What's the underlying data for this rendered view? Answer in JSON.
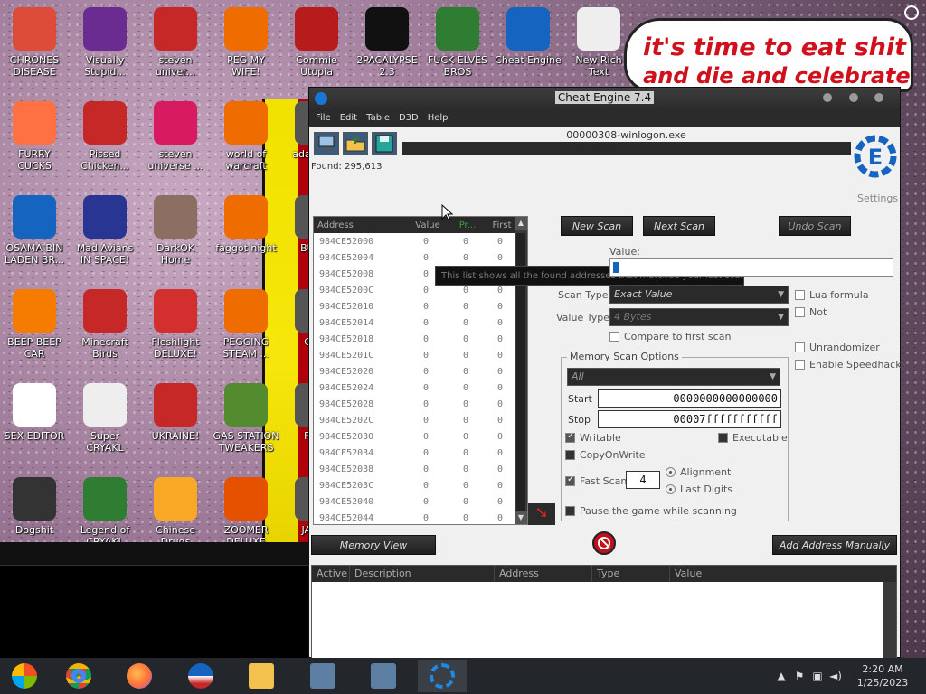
{
  "desktop": {
    "speech_line1": "it's time to eat shit",
    "speech_line2": "and die and celebrate",
    "icons": [
      {
        "label": "CHRONES DISEASE",
        "glyph": "chrome-icon",
        "color": "#dd4b39"
      },
      {
        "label": "Visually Stupid...",
        "glyph": "visual-studio-icon",
        "color": "#6a2c91"
      },
      {
        "label": "steven univer...",
        "glyph": "number-2-icon",
        "color": "#c62828"
      },
      {
        "label": "PEG MY WIFE!",
        "glyph": "p-logo-icon",
        "color": "#ef6c00"
      },
      {
        "label": "Commie Utopia",
        "glyph": "soviet-icon",
        "color": "#b71c1c"
      },
      {
        "label": "2PACALYPSE 2.3",
        "glyph": "cmd-icon",
        "color": "#111111"
      },
      {
        "label": "FUCK ELVES BROS",
        "glyph": "wizard-icon",
        "color": "#2e7d32"
      },
      {
        "label": "Cheat Engine",
        "glyph": "cheat-engine-icon",
        "color": "#1565c0"
      },
      {
        "label": "New Rich Text Document.rtf",
        "glyph": "document-icon",
        "color": "#eeeeee"
      },
      {
        "label": "FURRY CUCKS",
        "glyph": "firefox-icon",
        "color": "#ff7043"
      },
      {
        "label": "Pissed Chicken...",
        "glyph": "angry-bird-icon",
        "color": "#c62828"
      },
      {
        "label": "steven universe ...",
        "glyph": "gem-icon",
        "color": "#d81b60"
      },
      {
        "label": "world of warcraft",
        "glyph": "p-logo-icon",
        "color": "#ef6c00"
      },
      {
        "label": "adal simu",
        "glyph": "blank-icon",
        "color": "#555555"
      },
      {
        "label": "OSAMA BIN LADEN BR...",
        "glyph": "obama-logo-icon",
        "color": "#1565c0"
      },
      {
        "label": "Mad Avians IN SPACE!",
        "glyph": "angry-bird-icon",
        "color": "#283593"
      },
      {
        "label": "DarkOK Home",
        "glyph": "money-bag-icon",
        "color": "#8d6e63"
      },
      {
        "label": "faggot night",
        "glyph": "p-logo-icon",
        "color": "#ef6c00"
      },
      {
        "label": "BU OU",
        "glyph": "blank-icon",
        "color": "#555555"
      },
      {
        "label": "BEEP BEEP CAR",
        "glyph": "vlc-icon",
        "color": "#f57c00"
      },
      {
        "label": "Minecraft Birds",
        "glyph": "angry-bird-icon",
        "color": "#c62828"
      },
      {
        "label": "Fleshlight DELUXE!",
        "glyph": "red-puff-icon",
        "color": "#d32f2f"
      },
      {
        "label": "PEGGING STEAM ...",
        "glyph": "p-logo-icon",
        "color": "#ef6c00"
      },
      {
        "label": "C NU",
        "glyph": "blank-icon",
        "color": "#555555"
      },
      {
        "label": "SEX EDITOR",
        "glyph": "hxd-icon",
        "color": "#ffffff"
      },
      {
        "label": "Super CRYAKL",
        "glyph": "pixel-face-icon",
        "color": "#eeeeee"
      },
      {
        "label": "UKRAINE!",
        "glyph": "radiation-icon",
        "color": "#c62828"
      },
      {
        "label": "GAS STATION TWEAKERS",
        "glyph": "plants-icon",
        "color": "#558b2f"
      },
      {
        "label": "FREE",
        "glyph": "blank-icon",
        "color": "#555555"
      },
      {
        "label": "Dogshit",
        "glyph": "cpp-icon",
        "color": "#333333"
      },
      {
        "label": "Legend of CRYAKL",
        "glyph": "pixel-hero-icon",
        "color": "#2e7d32"
      },
      {
        "label": "Chinese Drugs",
        "glyph": "mahjong-icon",
        "color": "#f9a825"
      },
      {
        "label": "ZOOMER DELUXE",
        "glyph": "zuma-icon",
        "color": "#e65100"
      },
      {
        "label": "JA ANI",
        "glyph": "blank-icon",
        "color": "#555555"
      }
    ]
  },
  "cheat_engine": {
    "title": "Cheat Engine 7.4",
    "menu": [
      "File",
      "Edit",
      "Table",
      "D3D",
      "Help"
    ],
    "process": "00000308-winlogon.exe",
    "found": "Found: 295,613",
    "settings": "Settings",
    "results_headers": [
      "Address",
      "Value",
      "Pr...",
      "First"
    ],
    "results": [
      {
        "address": "984CE52000",
        "value": "0",
        "prev": "0",
        "first": "0"
      },
      {
        "address": "984CE52004",
        "value": "0",
        "prev": "0",
        "first": "0"
      },
      {
        "address": "984CE52008",
        "value": "0",
        "prev": "0",
        "first": "0"
      },
      {
        "address": "984CE5200C",
        "value": "0",
        "prev": "0",
        "first": "0"
      },
      {
        "address": "984CE52010",
        "value": "0",
        "prev": "0",
        "first": "0"
      },
      {
        "address": "984CE52014",
        "value": "0",
        "prev": "0",
        "first": "0"
      },
      {
        "address": "984CE52018",
        "value": "0",
        "prev": "0",
        "first": "0"
      },
      {
        "address": "984CE5201C",
        "value": "0",
        "prev": "0",
        "first": "0"
      },
      {
        "address": "984CE52020",
        "value": "0",
        "prev": "0",
        "first": "0"
      },
      {
        "address": "984CE52024",
        "value": "0",
        "prev": "0",
        "first": "0"
      },
      {
        "address": "984CE52028",
        "value": "0",
        "prev": "0",
        "first": "0"
      },
      {
        "address": "984CE5202C",
        "value": "0",
        "prev": "0",
        "first": "0"
      },
      {
        "address": "984CE52030",
        "value": "0",
        "prev": "0",
        "first": "0"
      },
      {
        "address": "984CE52034",
        "value": "0",
        "prev": "0",
        "first": "0"
      },
      {
        "address": "984CE52038",
        "value": "0",
        "prev": "0",
        "first": "0"
      },
      {
        "address": "984CE5203C",
        "value": "0",
        "prev": "0",
        "first": "0"
      },
      {
        "address": "984CE52040",
        "value": "0",
        "prev": "0",
        "first": "0"
      },
      {
        "address": "984CE52044",
        "value": "0",
        "prev": "0",
        "first": "0"
      }
    ],
    "tooltip": "This list shows all the found addresses that matched your last scan",
    "new_scan": "New Scan",
    "next_scan": "Next Scan",
    "undo_scan": "Undo Scan",
    "value_label": "Value:",
    "scan_type_label": "Scan Type",
    "scan_type": "Exact Value",
    "value_type_label": "Value Type",
    "value_type": "4 Bytes",
    "compare_first": "Compare to first scan",
    "lua_formula": "Lua formula",
    "not": "Not",
    "unrandomizer": "Unrandomizer",
    "enable_speedhack": "Enable Speedhack",
    "mem_options_title": "Memory Scan Options",
    "mem_region": "All",
    "start_label": "Start",
    "start_value": "0000000000000000",
    "stop_label": "Stop",
    "stop_value": "00007fffffffffff",
    "writable": "Writable",
    "executable": "Executable",
    "copy_on_write": "CopyOnWrite",
    "fast_scan": "Fast Scan",
    "fast_scan_value": "4",
    "alignment": "Alignment",
    "last_digits": "Last Digits",
    "pause_game": "Pause the game while scanning",
    "memory_view": "Memory View",
    "add_address": "Add Address Manually",
    "table_headers": [
      "Active",
      "Description",
      "Address",
      "Type",
      "Value"
    ]
  },
  "taskbar": {
    "time": "2:20 AM",
    "date": "1/25/2023",
    "pinned": [
      "start-icon",
      "chrome-icon",
      "firefox-icon",
      "obama-logo-icon",
      "file-explorer-icon",
      "installer-icon",
      "installer-icon",
      "cheat-engine-icon"
    ]
  }
}
